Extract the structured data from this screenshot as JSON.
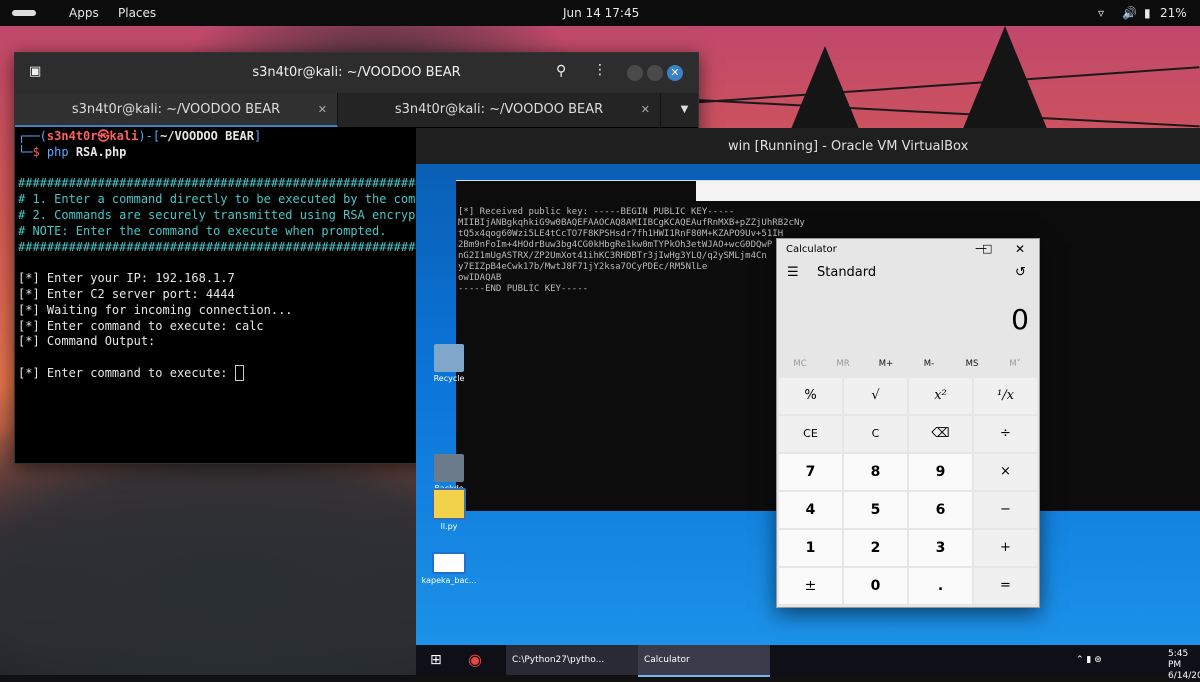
{
  "topbar": {
    "apps": "Apps",
    "places": "Places",
    "datetime": "Jun 14  17:45",
    "battery": "21%"
  },
  "terminal": {
    "title": "s3n4t0r@kali: ~/VOODOO BEAR",
    "tabs": [
      "s3n4t0r@kali: ~/VOODOO BEAR",
      "s3n4t0r@kali: ~/VOODOO BEAR"
    ],
    "prompt_user": "s3n4t0r㉿kali",
    "prompt_path": "~/VOODOO BEAR",
    "command_bin": "php",
    "command_arg": "RSA.php",
    "banner_rule": "##############################################################################",
    "banner_lines": [
      "# 1. Enter a command directly to be executed by the compromised system.",
      "# 2. Commands are securely transmitted using RSA encryption.",
      "# NOTE: Enter the command to execute when prompted."
    ],
    "output_lines": [
      "[*] Enter your IP: 192.168.1.7",
      "[*] Enter C2 server port: 4444",
      "[*] Waiting for incoming connection...",
      "[*] Enter command to execute: calc",
      "[*] Command Output:",
      "",
      "[*] Enter command to execute: "
    ]
  },
  "virtualbox": {
    "title": "win [Running] - Oracle VM VirtualBox",
    "cmd_lines": [
      "[*] Received public key: -----BEGIN PUBLIC KEY-----",
      "MIIBIjANBgkqhkiG9w0BAQEFAAOCAQ8AMIIBCgKCAQEAufRnMXB+pZZjUhRB2cNy",
      "tQ5x4qog60Wzi5LE4tCcTO7F8KPSHsdr7fh1HWI1RnF80M+KZAPO9Uv+51IH",
      "2Bm9nFoIm+4HOdrBuw3bg4CG0kHbgRe1kw0mTYPkOh3etWJAO+wcG0DQwP",
      "nG2I1mUgASTRX/ZP2UmXot41ihKC3RHDBTr3jIwHg3YLQ/q2ySMLjm4Cn",
      "y7EIZpB4eCwk17b/MwtJ8F71jY2ksa7OCyPDEc/RM5NlLe",
      "owIDAQAB",
      "-----END PUBLIC KEY-----"
    ],
    "desktop_icons": [
      "Recycle",
      "Backdo",
      "ll.py",
      "kapeka_bac..."
    ],
    "taskbar": {
      "python_task": "C:\\Python27\\pytho...",
      "calculator_task": "Calculator",
      "clock_time": "5:45 PM",
      "clock_date": "6/14/20"
    }
  },
  "calculator": {
    "title": "Calculator",
    "mode": "Standard",
    "display": "0",
    "memory": [
      "MC",
      "MR",
      "M+",
      "M-",
      "MS",
      "M˅"
    ],
    "keys": [
      [
        "%",
        "√",
        "x²",
        "¹/x"
      ],
      [
        "CE",
        "C",
        "⌫",
        "÷"
      ],
      [
        "7",
        "8",
        "9",
        "×"
      ],
      [
        "4",
        "5",
        "6",
        "−"
      ],
      [
        "1",
        "2",
        "3",
        "+"
      ],
      [
        "±",
        "0",
        ".",
        "="
      ]
    ]
  }
}
